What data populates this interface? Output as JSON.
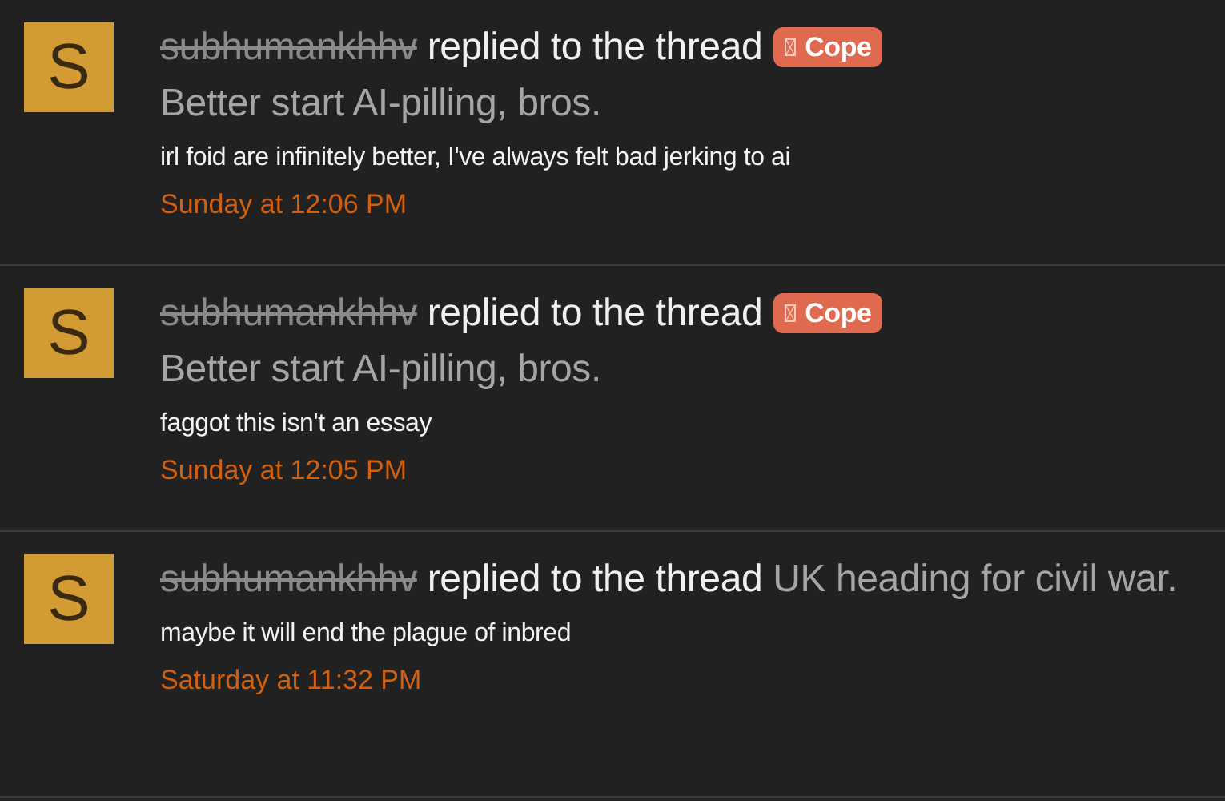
{
  "alerts": [
    {
      "avatar_letter": "S",
      "username": "subhumankhhv",
      "banned": true,
      "action": "replied to the thread",
      "prefix": {
        "label": "Cope",
        "color": "#e06a50"
      },
      "thread": "Better start AI-pilling, bros.",
      "snippet": "irl foid are infinitely better, I've always felt bad jerking to ai",
      "time": "Sunday at 12:06 PM"
    },
    {
      "avatar_letter": "S",
      "username": "subhumankhhv",
      "banned": true,
      "action": "replied to the thread",
      "prefix": {
        "label": "Cope",
        "color": "#e06a50"
      },
      "thread": "Better start AI-pilling, bros.",
      "snippet": "faggot this isn't an essay",
      "time": "Sunday at 12:05 PM"
    },
    {
      "avatar_letter": "S",
      "username": "subhumankhhv",
      "banned": true,
      "action": "replied to the thread",
      "thread": "UK heading for civil war.",
      "snippet": "maybe it will end the plague of inbred",
      "time": "Saturday at 11:32 PM"
    }
  ]
}
